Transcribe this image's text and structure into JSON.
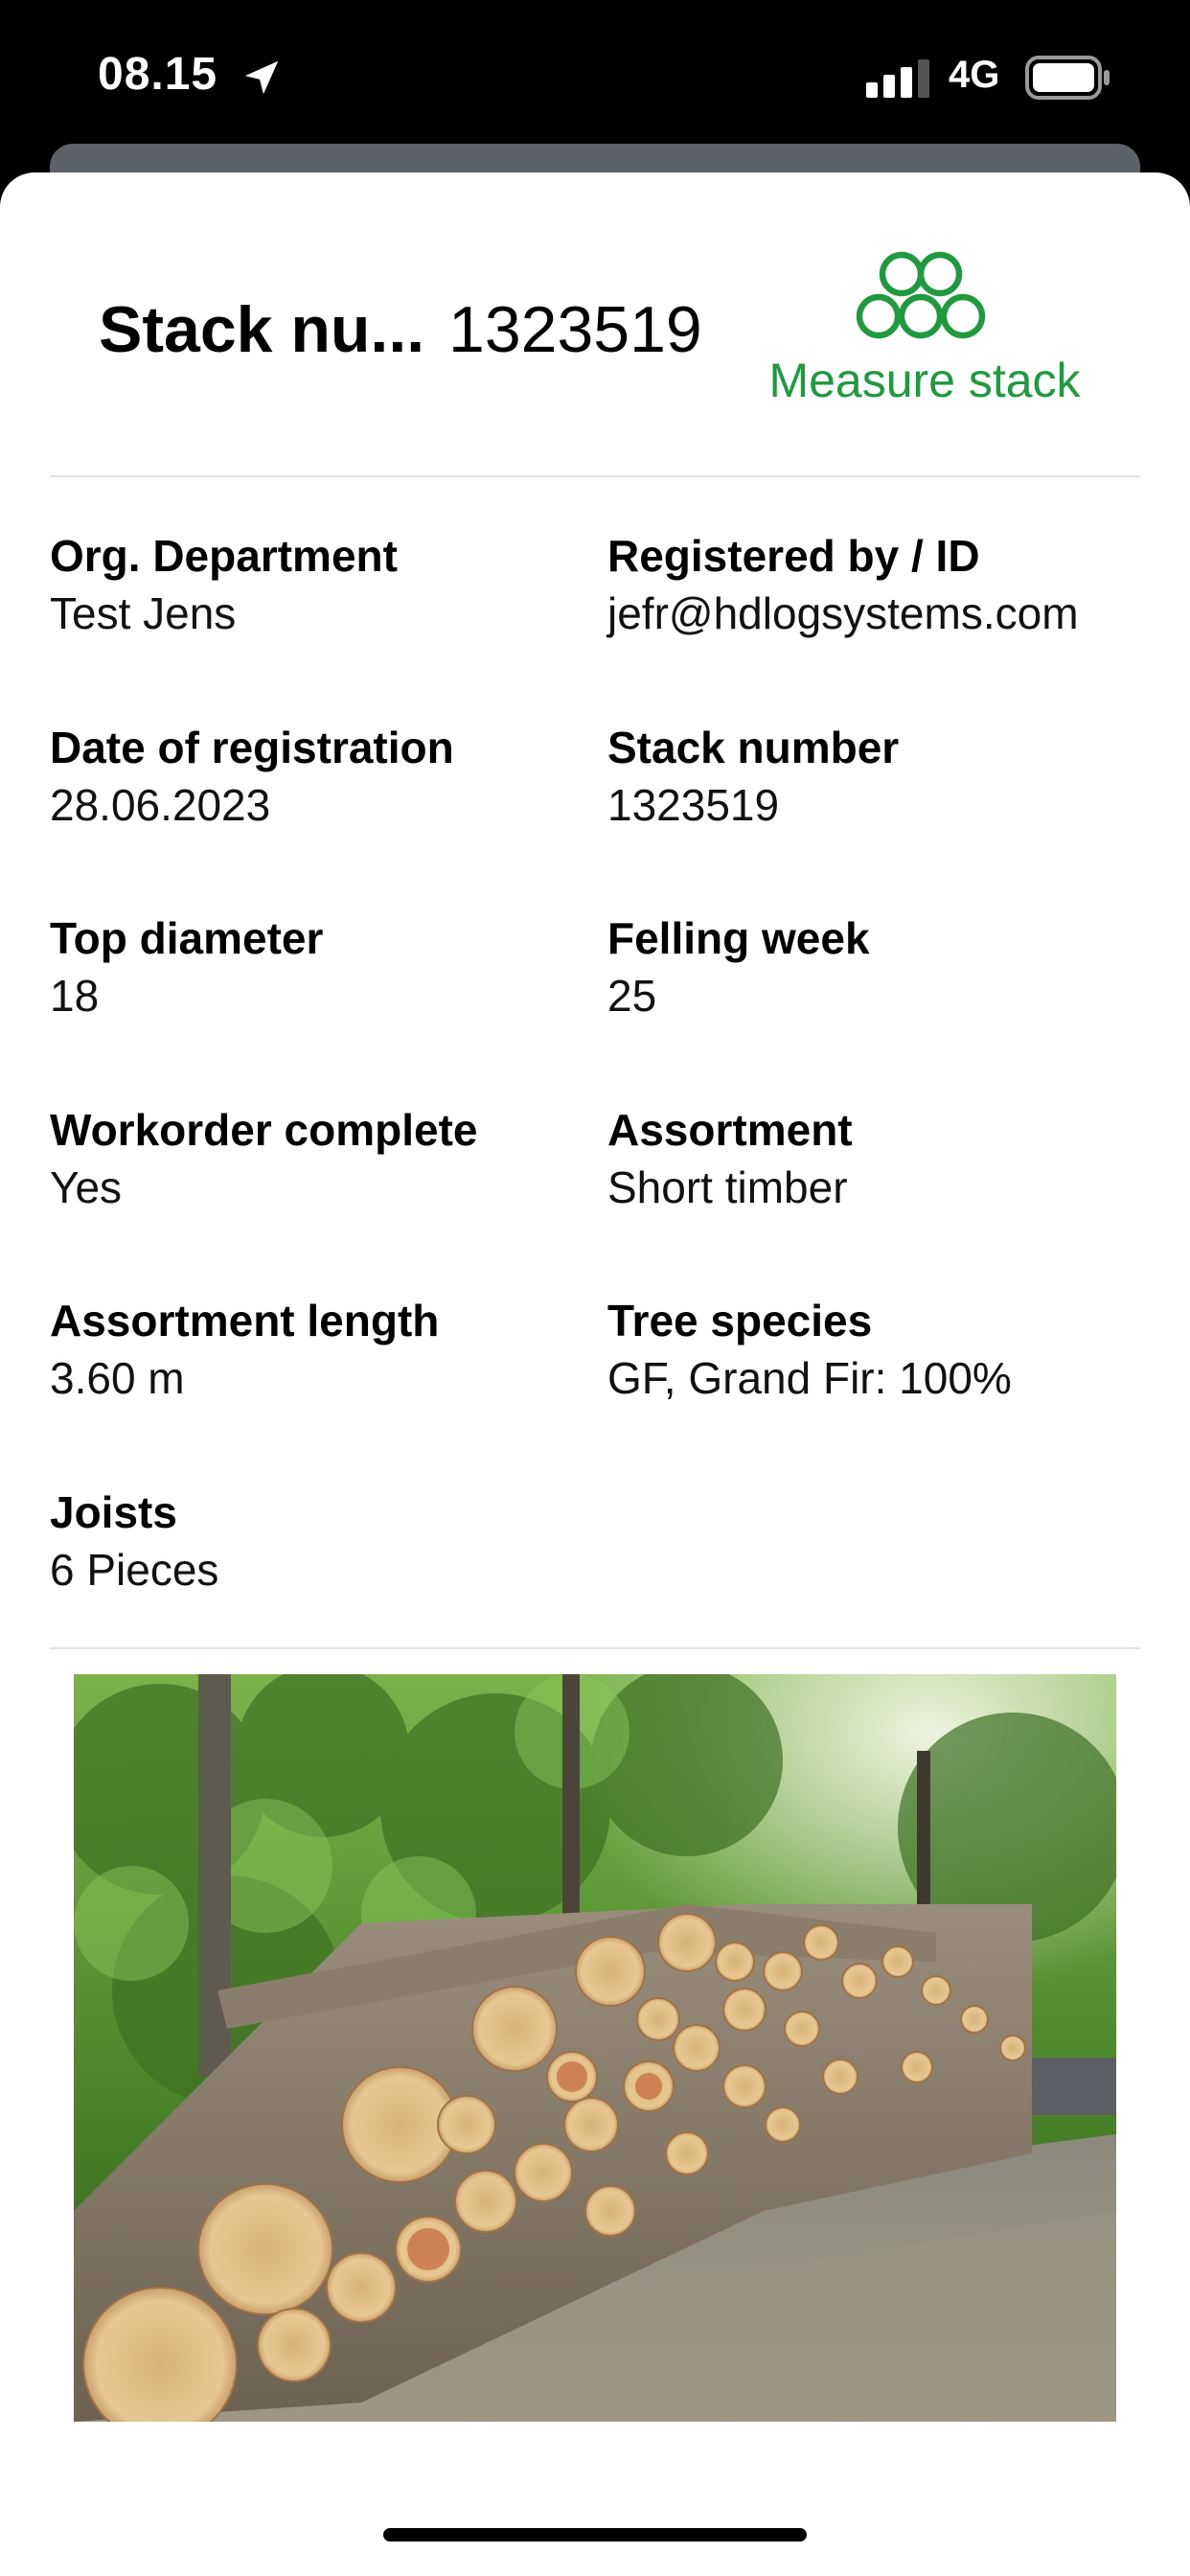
{
  "status_bar": {
    "time": "08.15",
    "network": "4G",
    "icons": [
      "location-arrow-icon",
      "signal-icon",
      "battery-icon"
    ]
  },
  "header": {
    "title_label": "Stack nu...",
    "title_value": "1323519",
    "measure_label": "Measure stack",
    "measure_icon": "log-stack-icon",
    "accent_color": "#1f9a3e"
  },
  "fields": {
    "org_department": {
      "label": "Org. Department",
      "value": "Test Jens"
    },
    "registered_by": {
      "label": "Registered by / ID",
      "value": "jefr@hdlogsystems.com"
    },
    "date_of_registration": {
      "label": "Date of registration",
      "value": "28.06.2023"
    },
    "stack_number": {
      "label": "Stack number",
      "value": "1323519"
    },
    "top_diameter": {
      "label": "Top diameter",
      "value": "18"
    },
    "felling_week": {
      "label": "Felling week",
      "value": "25"
    },
    "workorder_complete": {
      "label": "Workorder complete",
      "value": "Yes"
    },
    "assortment": {
      "label": "Assortment",
      "value": "Short timber"
    },
    "assortment_length": {
      "label": "Assortment length",
      "value": "3.60 m"
    },
    "tree_species": {
      "label": "Tree species",
      "value": "GF, Grand Fir: 100%"
    },
    "joists": {
      "label": "Joists",
      "value": "6 Pieces"
    }
  },
  "photo": {
    "subject": "log-stack-photo"
  }
}
